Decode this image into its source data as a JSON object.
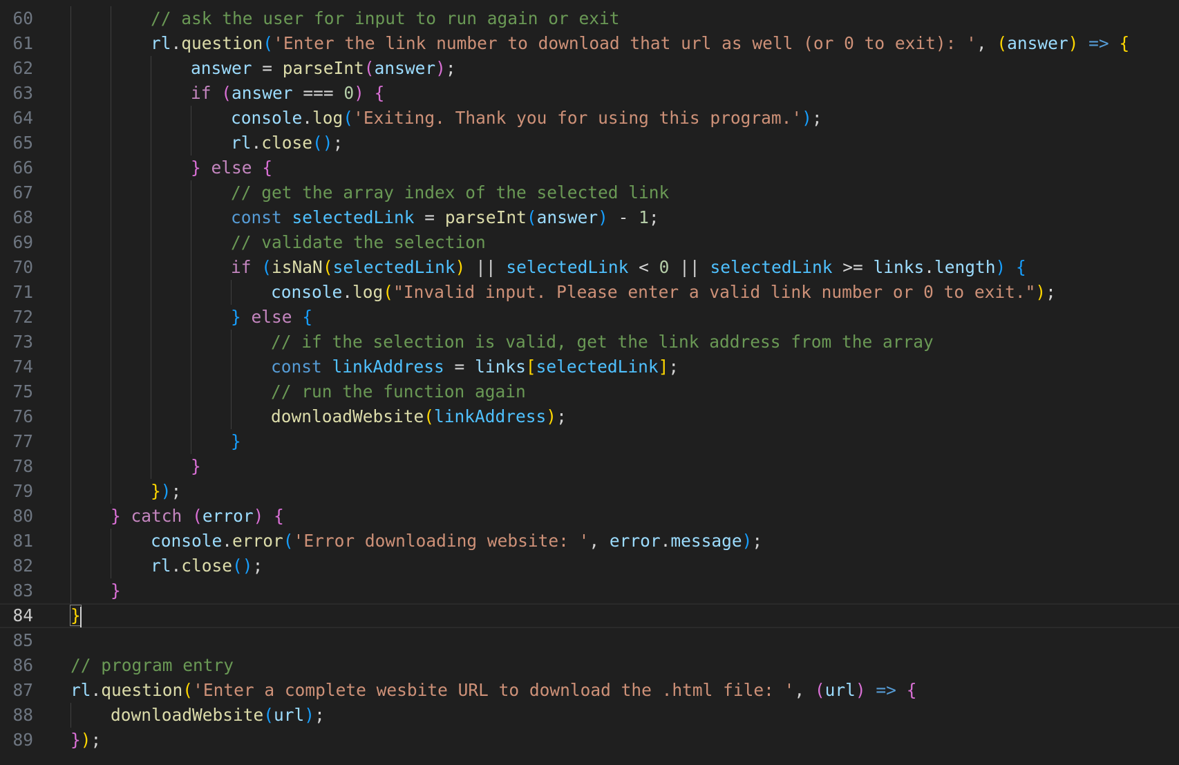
{
  "editor": {
    "language": "javascript",
    "current_line": "84",
    "colors": {
      "background": "#1f1f1f",
      "comment": "#6a9955",
      "variable": "#9cdcfe",
      "function": "#dcdcaa",
      "string": "#ce9178",
      "control_keyword": "#c586c0",
      "storage_keyword": "#569cd6",
      "bracket_level_1": "#ffd700",
      "bracket_level_2": "#da70d6",
      "bracket_level_3": "#179fff"
    },
    "lines": [
      {
        "num": "60",
        "indent": 2,
        "tokens": [
          [
            "com",
            "// ask the user for input to run again or exit"
          ]
        ]
      },
      {
        "num": "61",
        "indent": 2,
        "tokens": [
          [
            "var",
            "rl"
          ],
          [
            "op",
            "."
          ],
          [
            "fn",
            "question"
          ],
          [
            "p3",
            "("
          ],
          [
            "str",
            "'Enter the link number to download that url as well (or 0 to exit): '"
          ],
          [
            "op",
            ", "
          ],
          [
            "p1",
            "("
          ],
          [
            "var",
            "answer"
          ],
          [
            "p1",
            ")"
          ],
          [
            "op",
            " "
          ],
          [
            "st",
            "=>"
          ],
          [
            "op",
            " "
          ],
          [
            "p1",
            "{"
          ]
        ]
      },
      {
        "num": "62",
        "indent": 3,
        "tokens": [
          [
            "var",
            "answer"
          ],
          [
            "op",
            " = "
          ],
          [
            "fn",
            "parseInt"
          ],
          [
            "p2",
            "("
          ],
          [
            "var",
            "answer"
          ],
          [
            "p2",
            ")"
          ],
          [
            "op",
            ";"
          ]
        ]
      },
      {
        "num": "63",
        "indent": 3,
        "tokens": [
          [
            "kw",
            "if"
          ],
          [
            "op",
            " "
          ],
          [
            "p2",
            "("
          ],
          [
            "var",
            "answer"
          ],
          [
            "op",
            " === "
          ],
          [
            "num",
            "0"
          ],
          [
            "p2",
            ")"
          ],
          [
            "op",
            " "
          ],
          [
            "p2",
            "{"
          ]
        ]
      },
      {
        "num": "64",
        "indent": 4,
        "tokens": [
          [
            "var",
            "console"
          ],
          [
            "op",
            "."
          ],
          [
            "fn",
            "log"
          ],
          [
            "p3",
            "("
          ],
          [
            "str",
            "'Exiting. Thank you for using this program.'"
          ],
          [
            "p3",
            ")"
          ],
          [
            "op",
            ";"
          ]
        ]
      },
      {
        "num": "65",
        "indent": 4,
        "tokens": [
          [
            "var",
            "rl"
          ],
          [
            "op",
            "."
          ],
          [
            "fn",
            "close"
          ],
          [
            "p3",
            "()"
          ],
          [
            "op",
            ";"
          ]
        ]
      },
      {
        "num": "66",
        "indent": 3,
        "tokens": [
          [
            "p2",
            "}"
          ],
          [
            "op",
            " "
          ],
          [
            "kw",
            "else"
          ],
          [
            "op",
            " "
          ],
          [
            "p2",
            "{"
          ]
        ]
      },
      {
        "num": "67",
        "indent": 4,
        "tokens": [
          [
            "com",
            "// get the array index of the selected link"
          ]
        ]
      },
      {
        "num": "68",
        "indent": 4,
        "tokens": [
          [
            "st",
            "const"
          ],
          [
            "op",
            " "
          ],
          [
            "const",
            "selectedLink"
          ],
          [
            "op",
            " = "
          ],
          [
            "fn",
            "parseInt"
          ],
          [
            "p3",
            "("
          ],
          [
            "var",
            "answer"
          ],
          [
            "p3",
            ")"
          ],
          [
            "op",
            " - "
          ],
          [
            "num",
            "1"
          ],
          [
            "op",
            ";"
          ]
        ]
      },
      {
        "num": "69",
        "indent": 4,
        "tokens": [
          [
            "com",
            "// validate the selection"
          ]
        ]
      },
      {
        "num": "70",
        "indent": 4,
        "tokens": [
          [
            "kw",
            "if"
          ],
          [
            "op",
            " "
          ],
          [
            "p3",
            "("
          ],
          [
            "fn",
            "isNaN"
          ],
          [
            "p1",
            "("
          ],
          [
            "const",
            "selectedLink"
          ],
          [
            "p1",
            ")"
          ],
          [
            "op",
            " || "
          ],
          [
            "const",
            "selectedLink"
          ],
          [
            "op",
            " < "
          ],
          [
            "num",
            "0"
          ],
          [
            "op",
            " || "
          ],
          [
            "const",
            "selectedLink"
          ],
          [
            "op",
            " >= "
          ],
          [
            "var",
            "links"
          ],
          [
            "op",
            "."
          ],
          [
            "var",
            "length"
          ],
          [
            "p3",
            ")"
          ],
          [
            "op",
            " "
          ],
          [
            "p3",
            "{"
          ]
        ]
      },
      {
        "num": "71",
        "indent": 5,
        "tokens": [
          [
            "var",
            "console"
          ],
          [
            "op",
            "."
          ],
          [
            "fn",
            "log"
          ],
          [
            "p1",
            "("
          ],
          [
            "str",
            "\"Invalid input. Please enter a valid link number or 0 to exit.\""
          ],
          [
            "p1",
            ")"
          ],
          [
            "op",
            ";"
          ]
        ]
      },
      {
        "num": "72",
        "indent": 4,
        "tokens": [
          [
            "p3",
            "}"
          ],
          [
            "op",
            " "
          ],
          [
            "kw",
            "else"
          ],
          [
            "op",
            " "
          ],
          [
            "p3",
            "{"
          ]
        ]
      },
      {
        "num": "73",
        "indent": 5,
        "tokens": [
          [
            "com",
            "// if the selection is valid, get the link address from the array"
          ]
        ]
      },
      {
        "num": "74",
        "indent": 5,
        "tokens": [
          [
            "st",
            "const"
          ],
          [
            "op",
            " "
          ],
          [
            "const",
            "linkAddress"
          ],
          [
            "op",
            " = "
          ],
          [
            "var",
            "links"
          ],
          [
            "p1",
            "["
          ],
          [
            "const",
            "selectedLink"
          ],
          [
            "p1",
            "]"
          ],
          [
            "op",
            ";"
          ]
        ]
      },
      {
        "num": "75",
        "indent": 5,
        "tokens": [
          [
            "com",
            "// run the function again"
          ]
        ]
      },
      {
        "num": "76",
        "indent": 5,
        "tokens": [
          [
            "fn",
            "downloadWebsite"
          ],
          [
            "p1",
            "("
          ],
          [
            "const",
            "linkAddress"
          ],
          [
            "p1",
            ")"
          ],
          [
            "op",
            ";"
          ]
        ]
      },
      {
        "num": "77",
        "indent": 4,
        "tokens": [
          [
            "p3",
            "}"
          ]
        ]
      },
      {
        "num": "78",
        "indent": 3,
        "tokens": [
          [
            "p2",
            "}"
          ]
        ]
      },
      {
        "num": "79",
        "indent": 2,
        "tokens": [
          [
            "p1",
            "}"
          ],
          [
            "p3",
            ")"
          ],
          [
            "op",
            ";"
          ]
        ]
      },
      {
        "num": "80",
        "indent": 1,
        "tokens": [
          [
            "p2",
            "}"
          ],
          [
            "op",
            " "
          ],
          [
            "kw",
            "catch"
          ],
          [
            "op",
            " "
          ],
          [
            "p2",
            "("
          ],
          [
            "var",
            "error"
          ],
          [
            "p2",
            ")"
          ],
          [
            "op",
            " "
          ],
          [
            "p2",
            "{"
          ]
        ]
      },
      {
        "num": "81",
        "indent": 2,
        "tokens": [
          [
            "var",
            "console"
          ],
          [
            "op",
            "."
          ],
          [
            "fn",
            "error"
          ],
          [
            "p3",
            "("
          ],
          [
            "str",
            "'Error downloading website: '"
          ],
          [
            "op",
            ", "
          ],
          [
            "var",
            "error"
          ],
          [
            "op",
            "."
          ],
          [
            "var",
            "message"
          ],
          [
            "p3",
            ")"
          ],
          [
            "op",
            ";"
          ]
        ]
      },
      {
        "num": "82",
        "indent": 2,
        "tokens": [
          [
            "var",
            "rl"
          ],
          [
            "op",
            "."
          ],
          [
            "fn",
            "close"
          ],
          [
            "p3",
            "()"
          ],
          [
            "op",
            ";"
          ]
        ]
      },
      {
        "num": "83",
        "indent": 1,
        "tokens": [
          [
            "p2",
            "}"
          ]
        ]
      },
      {
        "num": "84",
        "indent": 0,
        "tokens": [
          [
            "p1",
            "}"
          ]
        ]
      },
      {
        "num": "85",
        "indent": 0,
        "tokens": []
      },
      {
        "num": "86",
        "indent": 0,
        "tokens": [
          [
            "com",
            "// program entry"
          ]
        ]
      },
      {
        "num": "87",
        "indent": 0,
        "tokens": [
          [
            "var",
            "rl"
          ],
          [
            "op",
            "."
          ],
          [
            "fn",
            "question"
          ],
          [
            "p1",
            "("
          ],
          [
            "str",
            "'Enter a complete wesbite URL to download the .html file: '"
          ],
          [
            "op",
            ", "
          ],
          [
            "p2",
            "("
          ],
          [
            "var",
            "url"
          ],
          [
            "p2",
            ")"
          ],
          [
            "op",
            " "
          ],
          [
            "st",
            "=>"
          ],
          [
            "op",
            " "
          ],
          [
            "p2",
            "{"
          ]
        ]
      },
      {
        "num": "88",
        "indent": 1,
        "tokens": [
          [
            "fn",
            "downloadWebsite"
          ],
          [
            "p3",
            "("
          ],
          [
            "var",
            "url"
          ],
          [
            "p3",
            ")"
          ],
          [
            "op",
            ";"
          ]
        ]
      },
      {
        "num": "89",
        "indent": 0,
        "tokens": [
          [
            "p2",
            "}"
          ],
          [
            "p1",
            ")"
          ],
          [
            "op",
            ";"
          ]
        ]
      }
    ]
  }
}
